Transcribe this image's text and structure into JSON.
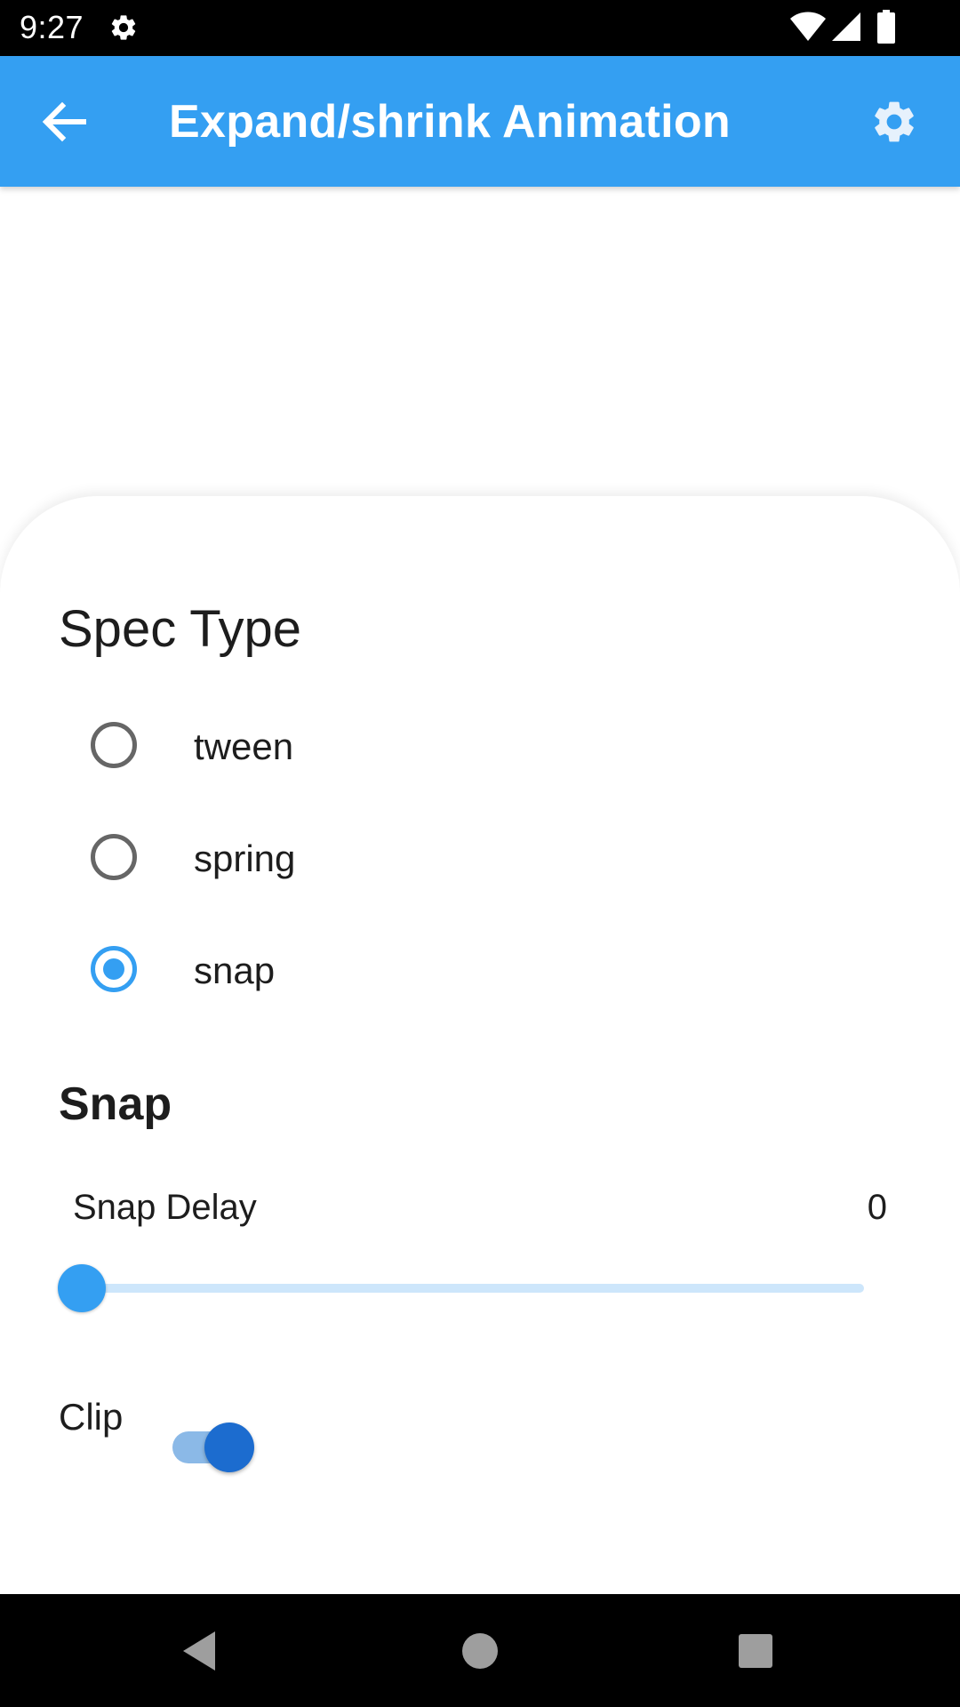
{
  "status_bar": {
    "time": "9:27",
    "icons": [
      "settings-gear-icon",
      "wifi-icon",
      "cell-signal-icon",
      "battery-icon"
    ]
  },
  "app_bar": {
    "title": "Expand/shrink Animation",
    "back_icon": "arrow-back-icon",
    "settings_icon": "settings-gear-icon",
    "color": "#349ff2"
  },
  "spec_type": {
    "title": "Spec Type",
    "options": [
      {
        "label": "tween",
        "selected": false
      },
      {
        "label": "spring",
        "selected": false
      },
      {
        "label": "snap",
        "selected": true
      }
    ]
  },
  "snap": {
    "heading": "Snap",
    "delay_label": "Snap Delay",
    "delay_value": "0",
    "slider_fraction": 0
  },
  "clip": {
    "label": "Clip",
    "enabled": true
  },
  "nav_bar": {
    "icons": [
      "back-triangle-icon",
      "home-circle-icon",
      "recents-square-icon"
    ]
  }
}
